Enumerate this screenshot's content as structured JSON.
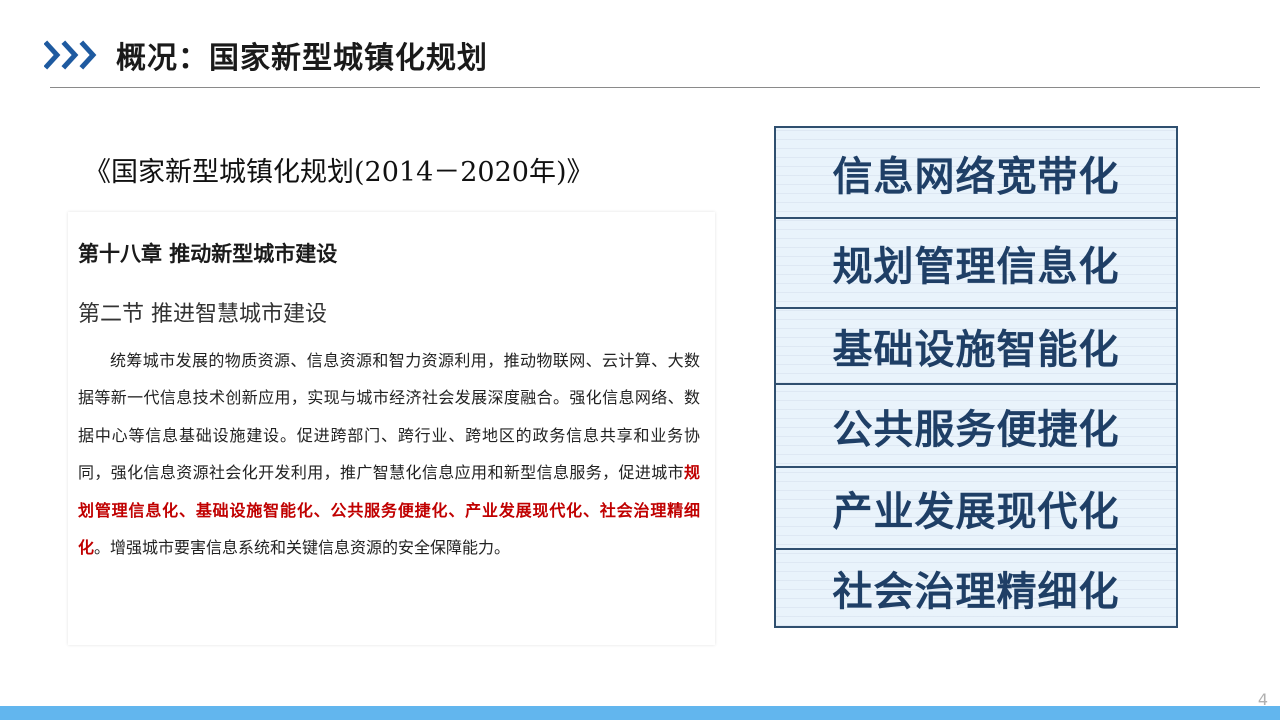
{
  "header": {
    "title": "概况：国家新型城镇化规划",
    "accent_color": "#1e5aa0",
    "icon": "chevron-triple-right-icon"
  },
  "document": {
    "title": "《国家新型城镇化规划(2014－2020年)》",
    "chapter": "第十八章  推动新型城市建设",
    "section": "第二节  推进智慧城市建设",
    "paragraph": {
      "before": "统筹城市发展的物质资源、信息资源和智力资源利用，推动物联网、云计算、大数据等新一代信息技术创新应用，实现与城市经济社会发展深度融合。强化信息网络、数据中心等信息基础设施建设。促进跨部门、跨行业、跨地区的政务信息共享和业务协同，强化信息资源社会化开发利用，推广智慧化信息应用和新型信息服务，促进城市",
      "highlight": "规划管理信息化、基础设施智能化、公共服务便捷化、产业发展现代化、社会治理精细化",
      "after": "。增强城市要害信息系统和关键信息资源的安全保障能力。"
    },
    "highlight_color": "#c00000"
  },
  "boxes": [
    "信息网络宽带化",
    "规划管理信息化",
    "基础设施智能化",
    "公共服务便捷化",
    "产业发展现代化",
    "社会治理精细化"
  ],
  "footer": {
    "page_number": "4",
    "bar_color": "#62b6ee"
  }
}
